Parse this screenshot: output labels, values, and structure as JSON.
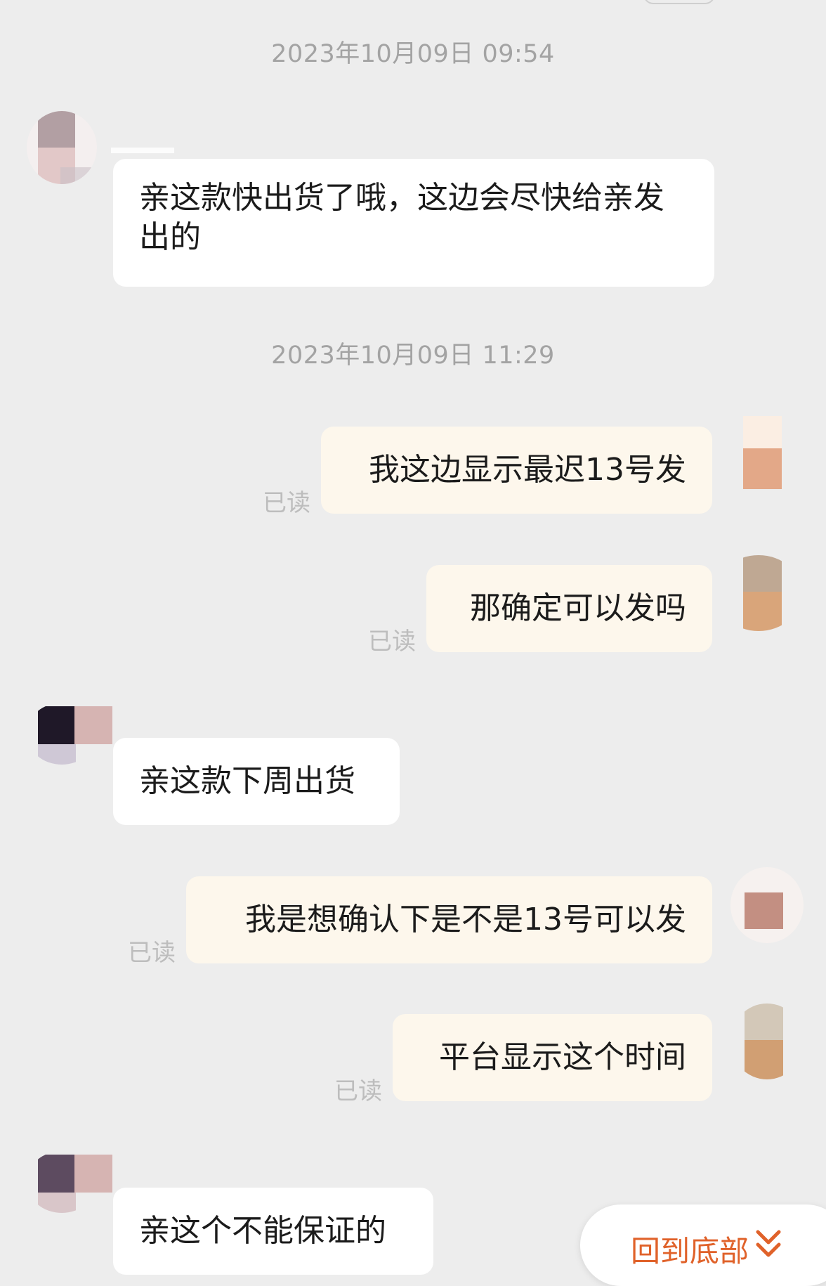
{
  "chat": {
    "timestamps": [
      "2023年10月09日 09:54",
      "2023年10月09日 11:29"
    ],
    "read_label": "已读",
    "messages": [
      {
        "side": "in",
        "text": "亲这款快出货了哦，这边会尽快给亲发出的"
      },
      {
        "side": "out",
        "text": "我这边显示最迟13号发",
        "status": "已读"
      },
      {
        "side": "out",
        "text": "那确定可以发吗",
        "status": "已读"
      },
      {
        "side": "in",
        "text": "亲这款下周出货"
      },
      {
        "side": "out",
        "text": "我是想确认下是不是13号可以发",
        "status": "已读"
      },
      {
        "side": "out",
        "text": "平台显示这个时间",
        "status": "已读"
      },
      {
        "side": "in",
        "text": "亲这个不能保证的"
      }
    ]
  },
  "footer": {
    "back_to_bottom_label": "回到底部",
    "back_to_bottom_icon": "double-chevron-down-icon",
    "accent_color": "#e0622a"
  },
  "colors": {
    "background": "#ededed",
    "incoming_bubble": "#ffffff",
    "outgoing_bubble": "#fdf7ec",
    "timestamp_text": "#a3a3a3",
    "read_text": "#bdbdbd"
  }
}
